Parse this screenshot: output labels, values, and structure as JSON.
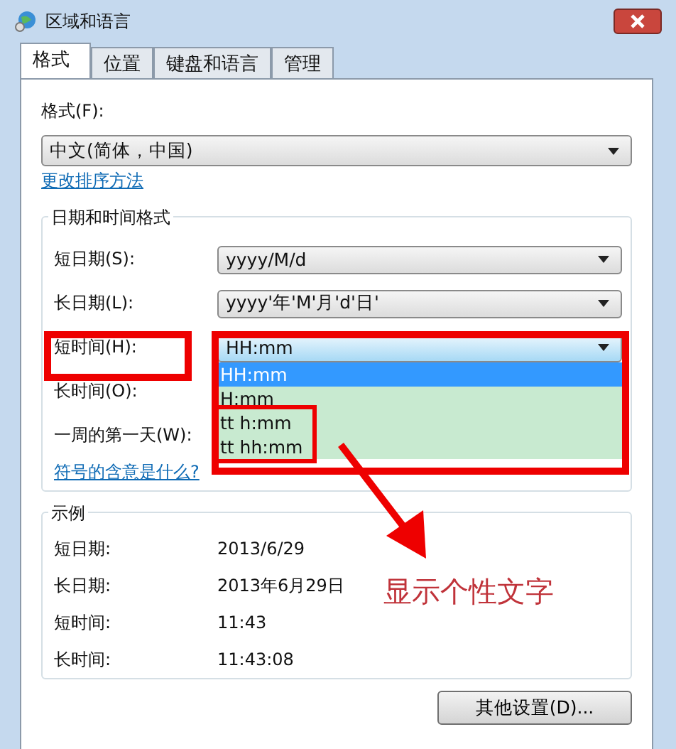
{
  "window": {
    "title": "区域和语言"
  },
  "tabs": [
    {
      "label": "格式",
      "selected": true
    },
    {
      "label": "位置",
      "selected": false
    },
    {
      "label": "键盘和语言",
      "selected": false
    },
    {
      "label": "管理",
      "selected": false
    }
  ],
  "format": {
    "label": "格式(F):",
    "value": "中文(简体，中国)",
    "link": "更改排序方法"
  },
  "date_time_formats": {
    "title": "日期和时间格式",
    "rows": [
      {
        "kind": "select",
        "label": "短日期(S):",
        "value": "yyyy/M/d"
      },
      {
        "kind": "select",
        "label": "长日期(L):",
        "value": "yyyy'年'M'月'd'日'"
      },
      {
        "kind": "select",
        "label": "短时间(H):",
        "value": "HH:mm",
        "expanded": true
      },
      {
        "kind": "label",
        "label": "长时间(O):"
      },
      {
        "kind": "label",
        "label": "一周的第一天(W):"
      }
    ],
    "options": [
      {
        "text": "HH:mm",
        "selected": true
      },
      {
        "text": "H:mm",
        "selected": false
      },
      {
        "text": "tt h:mm",
        "selected": false
      },
      {
        "text": "tt hh:mm",
        "selected": false
      }
    ],
    "link": "符号的含意是什么?"
  },
  "examples": {
    "title": "示例",
    "rows": [
      {
        "label": "短日期:",
        "value": "2013/6/29"
      },
      {
        "label": "长日期:",
        "value": "2013年6月29日"
      },
      {
        "label": "短时间:",
        "value": "11:43"
      },
      {
        "label": "长时间:",
        "value": "11:43:08"
      }
    ]
  },
  "buttons": [
    "其他设置(D)..."
  ],
  "annotation": {
    "text": "显示个性文字"
  }
}
